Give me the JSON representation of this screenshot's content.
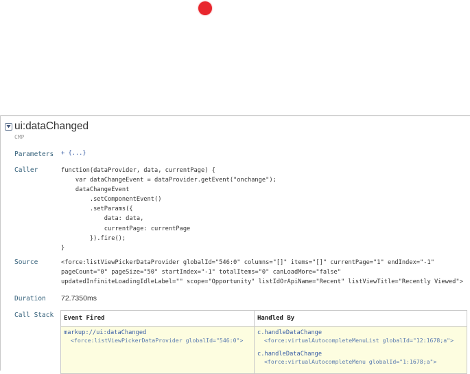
{
  "event": {
    "name": "ui:dataChanged",
    "type": "CMP"
  },
  "labels": {
    "parameters": "Parameters",
    "caller": "Caller",
    "source": "Source",
    "duration": "Duration",
    "call_stack": "Call Stack"
  },
  "parameters_text": "+ {...}",
  "caller_code": [
    "function(dataProvider, data, currentPage) {",
    "    var dataChangeEvent = dataProvider.getEvent(\"onchange\");",
    "    dataChangeEvent",
    "        .setComponentEvent()",
    "        .setParams({",
    "            data: data,",
    "            currentPage: currentPage",
    "        }).fire();",
    "}"
  ],
  "source_text": "<force:listViewPickerDataProvider globalId=\"546:0\" columns=\"[]\" items=\"[]\" currentPage=\"1\" endIndex=\"-1\" pageCount=\"0\" pageSize=\"50\" startIndex=\"-1\" totalItems=\"0\" canLoadMore=\"false\" updatedInfiniteLoadingIdleLabel=\"\" scope=\"Opportunity\" listIdOrApiName=\"Recent\" listViewTitle=\"Recently Viewed\">",
  "duration_value": "72.7350ms",
  "call_stack": {
    "headers": {
      "fired": "Event Fired",
      "handled": "Handled By"
    },
    "fired": {
      "link": "markup://ui:dataChanged",
      "component": "<force:listViewPickerDataProvider globalId=\"546:0\">"
    },
    "handlers": [
      {
        "name": "c.handleDataChange",
        "component": "<force:virtualAutocompleteMenuList globalId=\"12:1678;a\">"
      },
      {
        "name": "c.handleDataChange",
        "component": "<force:virtualAutocompleteMenu globalId=\"1:1678;a\">"
      }
    ]
  },
  "colors": {
    "record_dot": "#e8262d",
    "link": "#3b5fa6",
    "label": "#34607a",
    "table_cell_bg": "#fdfde0"
  },
  "icons": {
    "toggle": "chevron-down-icon",
    "record": "record-dot-icon"
  }
}
